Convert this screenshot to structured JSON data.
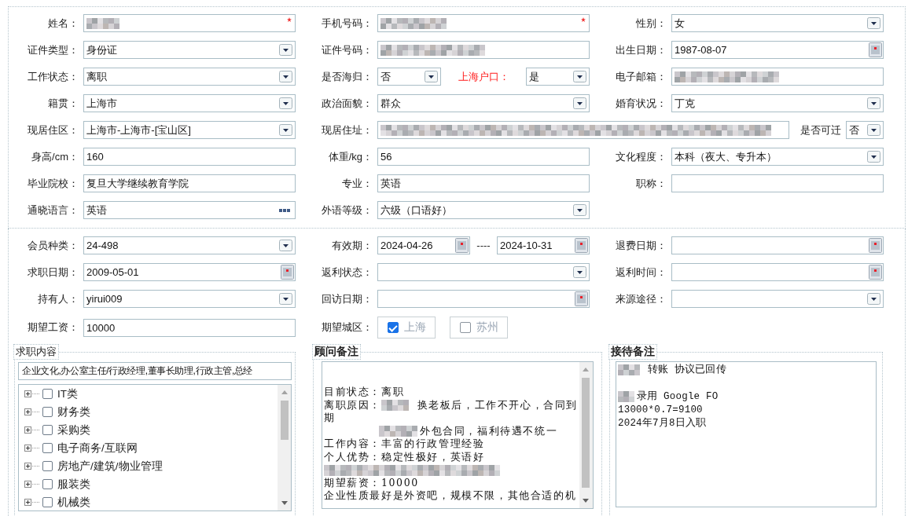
{
  "sections": [
    {
      "fields": [
        {
          "label": "姓名：",
          "required": true,
          "parts": [
            {
              "kind": "text",
              "redacted": true
            }
          ]
        },
        {
          "label": "手机号码：",
          "required": true,
          "parts": [
            {
              "kind": "text",
              "redacted": true
            }
          ]
        },
        {
          "label": "性别：",
          "required": false,
          "parts": [
            {
              "kind": "select",
              "value": "女"
            }
          ]
        },
        {
          "label": "证件类型：",
          "required": false,
          "parts": [
            {
              "kind": "select",
              "value": "身份证"
            }
          ]
        },
        {
          "label": "证件号码：",
          "required": false,
          "parts": [
            {
              "kind": "text",
              "redacted": true
            }
          ]
        },
        {
          "label": "出生日期：",
          "required": false,
          "parts": [
            {
              "kind": "date",
              "value": "1987-08-07"
            }
          ]
        },
        {
          "label": "工作状态：",
          "required": false,
          "parts": [
            {
              "kind": "select",
              "value": "离职"
            }
          ]
        },
        {
          "label": "是否海归：",
          "required": false,
          "parts": [
            {
              "kind": "select",
              "value": "否"
            },
            {
              "kind": "label",
              "text": "上海户口：",
              "emphasis": true
            },
            {
              "kind": "select",
              "value": "是"
            }
          ]
        },
        {
          "label": "电子邮箱：",
          "required": false,
          "parts": [
            {
              "kind": "text",
              "redacted": true
            }
          ]
        },
        {
          "label": "籍贯：",
          "required": false,
          "parts": [
            {
              "kind": "select",
              "value": "上海市"
            }
          ]
        },
        {
          "label": "政治面貌：",
          "required": false,
          "parts": [
            {
              "kind": "select",
              "value": "群众"
            }
          ]
        },
        {
          "label": "婚育状况：",
          "required": false,
          "parts": [
            {
              "kind": "select",
              "value": "丁克"
            }
          ]
        },
        {
          "label": "现居住区：",
          "required": false,
          "parts": [
            {
              "kind": "select",
              "value": "上海市-上海市-[宝山区]"
            }
          ]
        },
        {
          "label": "现居住址：",
          "required": false,
          "wide": true,
          "parts": [
            {
              "kind": "text",
              "redacted": true
            },
            {
              "kind": "label",
              "text": "是否可迁",
              "emphasis": false
            },
            {
              "kind": "select",
              "value": "否"
            }
          ]
        },
        {
          "label": "身高/cm：",
          "required": false,
          "parts": [
            {
              "kind": "text",
              "value": "160"
            }
          ]
        },
        {
          "label": "体重/kg：",
          "required": false,
          "parts": [
            {
              "kind": "text",
              "value": "56"
            }
          ]
        },
        {
          "label": "文化程度：",
          "required": false,
          "parts": [
            {
              "kind": "select",
              "value": "本科（夜大、专升本）"
            }
          ]
        },
        {
          "label": "毕业院校：",
          "required": false,
          "parts": [
            {
              "kind": "text",
              "value": "复旦大学继续教育学院"
            }
          ]
        },
        {
          "label": "专业：",
          "required": false,
          "parts": [
            {
              "kind": "text",
              "value": "英语"
            }
          ]
        },
        {
          "label": "职称：",
          "required": false,
          "parts": [
            {
              "kind": "text"
            }
          ]
        },
        {
          "label": "通晓语言：",
          "required": false,
          "parts": [
            {
              "kind": "lookup",
              "value": "英语"
            }
          ]
        },
        {
          "label": "外语等级：",
          "required": false,
          "parts": [
            {
              "kind": "select",
              "value": "六级（口语好）"
            }
          ]
        }
      ]
    },
    {
      "fields": [
        {
          "label": "会员种类：",
          "required": false,
          "parts": [
            {
              "kind": "select",
              "value": "24-498"
            }
          ]
        },
        {
          "label": "有效期：",
          "required": false,
          "parts": [
            {
              "kind": "date",
              "value": "2024-04-26"
            },
            {
              "kind": "label",
              "text": "----",
              "emphasis": false
            },
            {
              "kind": "date",
              "value": "2024-10-31"
            }
          ]
        },
        {
          "label": "退费日期：",
          "required": false,
          "parts": [
            {
              "kind": "date"
            }
          ]
        },
        {
          "label": "求职日期：",
          "required": false,
          "parts": [
            {
              "kind": "date",
              "value": "2009-05-01"
            }
          ]
        },
        {
          "label": "返利状态：",
          "required": false,
          "parts": [
            {
              "kind": "select"
            }
          ]
        },
        {
          "label": "返利时间：",
          "required": false,
          "parts": [
            {
              "kind": "date"
            }
          ]
        },
        {
          "label": "持有人：",
          "required": false,
          "parts": [
            {
              "kind": "select",
              "value": "yirui009"
            }
          ]
        },
        {
          "label": "回访日期：",
          "required": false,
          "parts": [
            {
              "kind": "date"
            }
          ]
        },
        {
          "label": "来源途径：",
          "required": false,
          "parts": [
            {
              "kind": "select"
            }
          ]
        },
        {
          "label": "期望工资：",
          "required": false,
          "parts": [
            {
              "kind": "text",
              "value": "10000"
            }
          ]
        },
        {
          "label": "期望城区：",
          "required": false,
          "parts": [
            {
              "kind": "checkbox",
              "text": "上海",
              "checked": true
            },
            {
              "kind": "checkbox",
              "text": "苏州",
              "checked": false
            }
          ]
        }
      ]
    }
  ],
  "panels": [
    {
      "kind": "tree",
      "title": "求职内容",
      "summary": "企业文化,办公室主任/行政经理,董事长助理,行政主管,总经",
      "items": [
        {
          "label": "IT类",
          "checked": false,
          "expanded": false
        },
        {
          "label": "财务类",
          "checked": false,
          "expanded": false
        },
        {
          "label": "采购类",
          "checked": false,
          "expanded": false
        },
        {
          "label": "电子商务/互联网",
          "checked": false,
          "expanded": false
        },
        {
          "label": "房地产/建筑/物业管理",
          "checked": false,
          "expanded": false
        },
        {
          "label": "服装类",
          "checked": false,
          "expanded": false
        },
        {
          "label": "机械类",
          "checked": false,
          "expanded": false
        }
      ]
    },
    {
      "kind": "note",
      "title": "顾问备注",
      "lines": [
        {
          "segments": [
            {
              "kind": "text",
              "text": "目前状态：离职"
            }
          ]
        },
        {
          "segments": [
            {
              "kind": "text",
              "text": "离职原因："
            },
            {
              "kind": "blur"
            },
            {
              "kind": "text",
              "text": " 换老板后，工作不开心，合同到"
            }
          ]
        },
        {
          "segments": [
            {
              "kind": "text",
              "text": "期"
            }
          ]
        },
        {
          "segments": [
            {
              "kind": "indent"
            },
            {
              "kind": "blur"
            },
            {
              "kind": "text",
              "text": "外包合同，福利待遇不统一"
            }
          ]
        },
        {
          "segments": [
            {
              "kind": "text",
              "text": "工作内容：丰富的行政管理经验"
            }
          ]
        },
        {
          "segments": [
            {
              "kind": "text",
              "text": "个人优势：稳定性极好，英语好"
            }
          ]
        },
        {
          "segments": [
            {
              "kind": "blur"
            }
          ]
        },
        {
          "segments": [
            {
              "kind": "text",
              "text": "期望薪资：10000"
            }
          ]
        },
        {
          "segments": [
            {
              "kind": "text",
              "text": "企业性质最好是外资吧，规模不限，其他合适的机"
            }
          ]
        }
      ]
    },
    {
      "kind": "memo",
      "title": "接待备注",
      "lines": [
        {
          "segments": [
            {
              "kind": "blur"
            },
            {
              "kind": "text",
              "text": " 转账 协议已回传"
            }
          ]
        },
        {
          "segments": [
            {
              "kind": "blank"
            }
          ]
        },
        {
          "segments": [
            {
              "kind": "blur"
            },
            {
              "kind": "text",
              "text": "录用  Google FO"
            }
          ]
        },
        {
          "segments": [
            {
              "kind": "text",
              "text": "13000*0.7=9100"
            }
          ]
        },
        {
          "segments": [
            {
              "kind": "text",
              "text": "2024年7月8日入职"
            }
          ]
        }
      ]
    }
  ]
}
